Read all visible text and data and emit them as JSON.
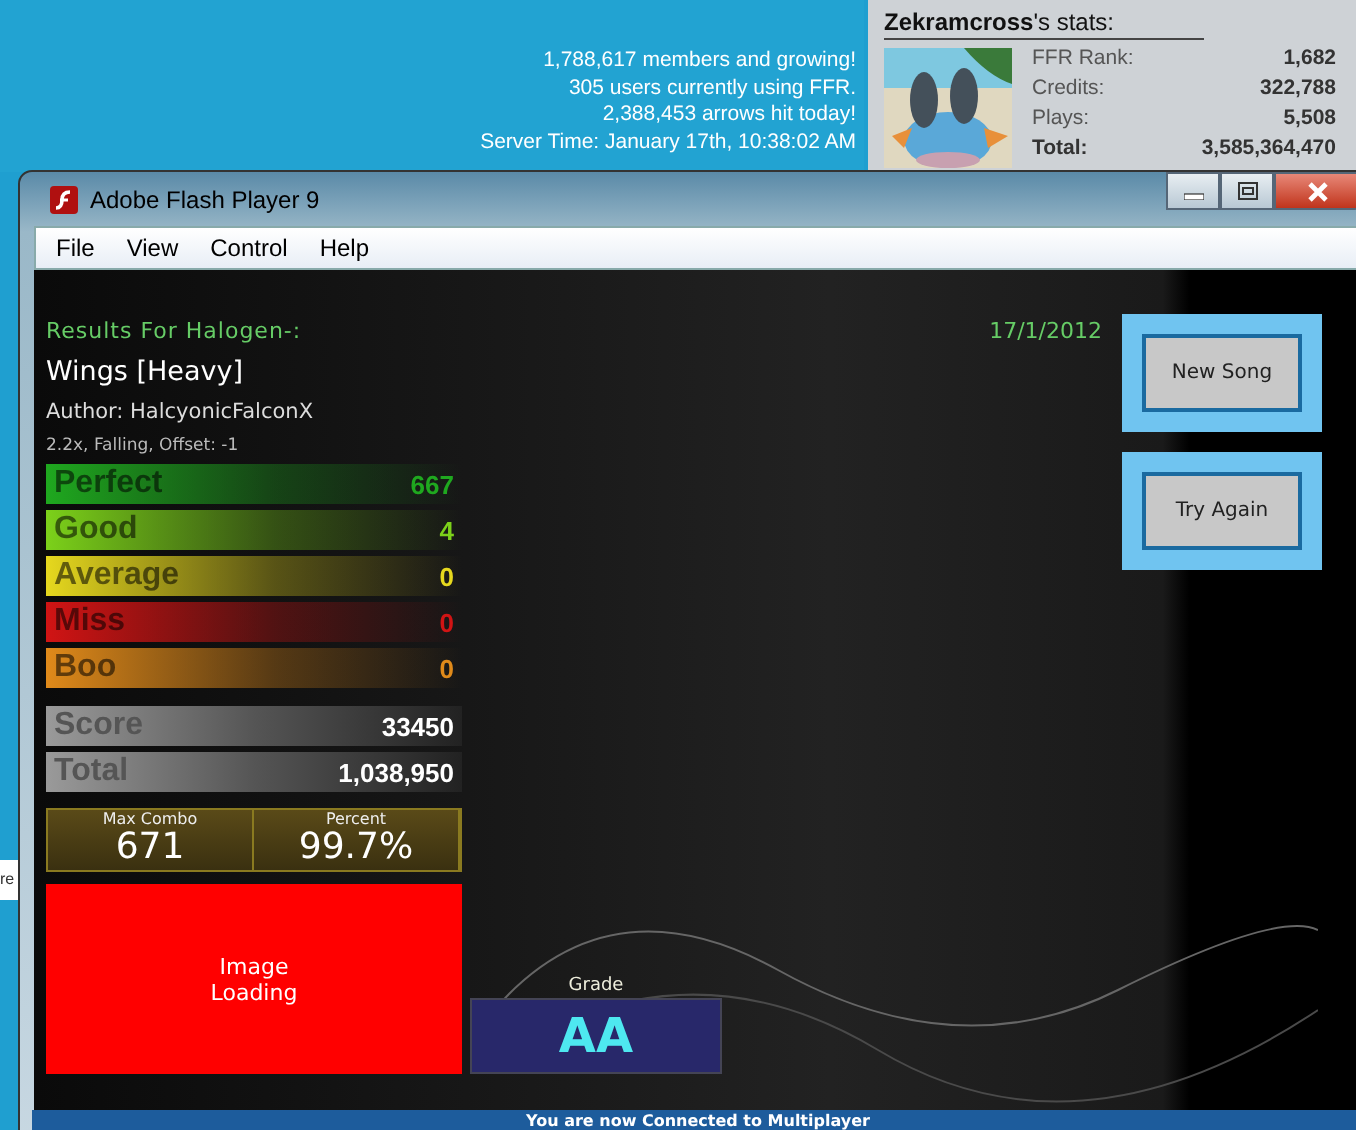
{
  "site_stats": {
    "lines": [
      "1,788,617 members and growing!",
      "305 users currently using FFR.",
      "2,388,453 arrows hit today!",
      "Server Time: January 17th, 10:38:02 AM"
    ]
  },
  "user_stats": {
    "title": "**Zekramcross**'s stats:",
    "rows": [
      {
        "label": "FFR Rank:",
        "value": "1,682",
        "bold": false
      },
      {
        "label": "Credits:",
        "value": "322,788",
        "bold": false
      },
      {
        "label": "Plays:",
        "value": "5,508",
        "bold": false
      },
      {
        "label": "Total:",
        "value": "3,585,364,470",
        "bold": true
      }
    ]
  },
  "background_fragment": "re",
  "window": {
    "title": "Adobe Flash Player 9",
    "menu": [
      "File",
      "View",
      "Control",
      "Help"
    ]
  },
  "results": {
    "heading": "Results For Halogen-:",
    "date": "17/1/2012",
    "song": "Wings [Heavy]",
    "author": "Author: HalcyonicFalconX",
    "settings": "2.2x, Falling, Offset: -1",
    "judgments": [
      {
        "label": "Perfect",
        "value": "667",
        "color": "#1fa81f"
      },
      {
        "label": "Good",
        "value": "4",
        "color": "#7cd11a"
      },
      {
        "label": "Average",
        "value": "0",
        "color": "#e6d81e"
      },
      {
        "label": "Miss",
        "value": "0",
        "color": "#d11414"
      },
      {
        "label": "Boo",
        "value": "0",
        "color": "#e08a1a"
      }
    ],
    "totals": [
      {
        "label": "Score",
        "value": "33450"
      },
      {
        "label": "Total",
        "value": "1,038,950"
      }
    ],
    "combo": {
      "label": "Max Combo",
      "value": "671"
    },
    "percent": {
      "label": "Percent",
      "value": "99.7%"
    },
    "image_placeholder": "Image\nLoading",
    "grade": {
      "label": "Grade",
      "value": "AA"
    }
  },
  "buttons": [
    "New Song",
    "Try Again"
  ],
  "status": "You are now Connected to Multiplayer"
}
